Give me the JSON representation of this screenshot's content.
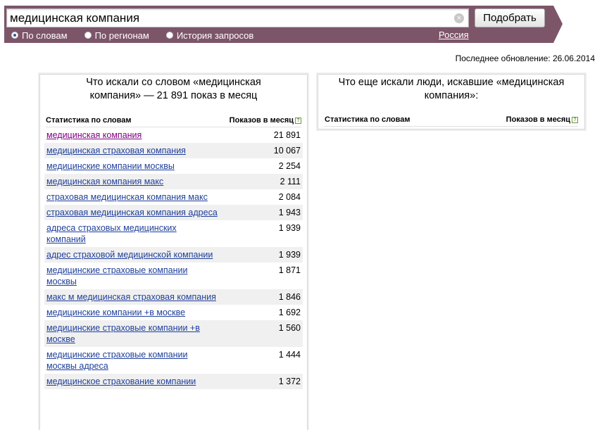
{
  "search": {
    "query": "медицинская компания",
    "clear_symbol": "×",
    "submit_label": "Подобрать"
  },
  "modes": [
    {
      "label": "По словам",
      "selected": true
    },
    {
      "label": "По регионам",
      "selected": false
    },
    {
      "label": "История запросов",
      "selected": false
    }
  ],
  "region": "Россия",
  "last_update": "Последнее обновление: 26.06.2014",
  "left_panel": {
    "title": "Что искали со словом «медицинская компания» — 21 891 показ в месяц",
    "col_keyword": "Статистика по словам",
    "col_count": "Показов в месяц",
    "help": "?",
    "rows": [
      {
        "phrase": "медицинская компания",
        "count": "21 891"
      },
      {
        "phrase": "медицинская страховая компания",
        "count": "10 067"
      },
      {
        "phrase": "медицинские компании москвы",
        "count": "2 254"
      },
      {
        "phrase": "медицинская компания макс",
        "count": "2 111"
      },
      {
        "phrase": "страховая медицинская компания макс",
        "count": "2 084"
      },
      {
        "phrase": "страховая медицинская компания адреса",
        "count": "1 943"
      },
      {
        "phrase": "адреса страховых медицинских компаний",
        "count": "1 939"
      },
      {
        "phrase": "адрес страховой медицинской компании",
        "count": "1 939"
      },
      {
        "phrase": "медицинские страховые компании москвы",
        "count": "1 871"
      },
      {
        "phrase": "макс м медицинская страховая компания",
        "count": "1 846"
      },
      {
        "phrase": "медицинские компании +в москве",
        "count": "1 692"
      },
      {
        "phrase": "медицинские страховые компании +в москве",
        "count": "1 560"
      },
      {
        "phrase": "медицинские страховые компании москвы адреса",
        "count": "1 444"
      },
      {
        "phrase": "медицинское страхование компании",
        "count": "1 372"
      }
    ]
  },
  "right_panel": {
    "title": "Что еще искали люди, искавшие «медицинская компания»:",
    "col_keyword": "Статистика по словам",
    "col_count": "Показов в месяц",
    "help": "?"
  }
}
